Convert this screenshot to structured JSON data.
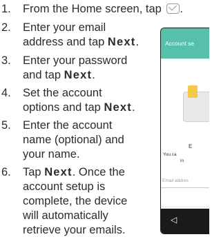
{
  "instructions": [
    {
      "num": "1.",
      "lines": [
        [
          "From the Home screen, tap ",
          "",
          ""
        ]
      ],
      "icon": "email-app-icon"
    },
    {
      "num": "2.",
      "lines": [
        [
          "Enter your email",
          "",
          ""
        ],
        [
          "address and tap ",
          "Next",
          "."
        ]
      ]
    },
    {
      "num": "3.",
      "lines": [
        [
          "Enter your password",
          "",
          ""
        ],
        [
          "and tap ",
          "Next",
          "."
        ]
      ]
    },
    {
      "num": "4.",
      "lines": [
        [
          "Set the account",
          "",
          ""
        ],
        [
          "options and tap ",
          "Next",
          "."
        ]
      ]
    },
    {
      "num": "5.",
      "lines": [
        [
          "Enter the account",
          "",
          ""
        ],
        [
          "name (optional) and",
          "",
          ""
        ],
        [
          "your name.",
          "",
          ""
        ]
      ]
    },
    {
      "num": "6.",
      "lines": [
        [
          "Tap ",
          "Next",
          ". Once the"
        ],
        [
          "account setup is",
          "",
          ""
        ],
        [
          "complete, the device",
          "",
          ""
        ],
        [
          "will automatically",
          "",
          ""
        ],
        [
          "retrieve your emails.",
          "",
          ""
        ]
      ]
    }
  ],
  "phone": {
    "appbar_title": "Account se",
    "text_e": "E",
    "text_you_can": "You ca",
    "text_in": "in",
    "email_field_placeholder": "Email addres",
    "nav_back_glyph": "◁",
    "colors": {
      "appbar": "#57c0ad",
      "next_button": "#64c6b4",
      "navbar": "#1a1a1a"
    }
  }
}
